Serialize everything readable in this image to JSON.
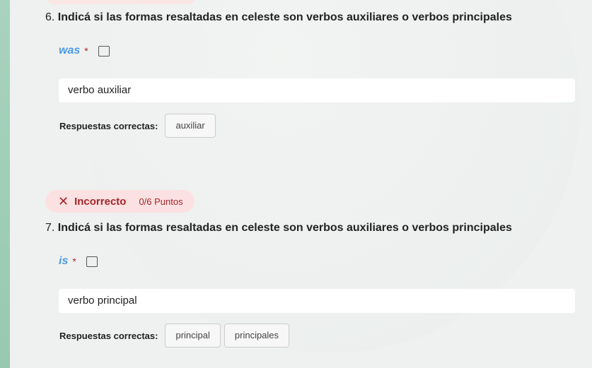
{
  "questions": [
    {
      "number": "6.",
      "title": "Indicá si las formas resaltadas en celeste son verbos auxiliares o verbos principales",
      "word": "was",
      "required": "*",
      "answer": "verbo auxiliar",
      "correct_label": "Respuestas correctas:",
      "correct": [
        "auxiliar"
      ]
    },
    {
      "number": "7.",
      "title": "Indicá si las formas resaltadas en celeste son verbos auxiliares o verbos principales",
      "word": "is",
      "required": "*",
      "answer": "verbo principal",
      "correct_label": "Respuestas correctas:",
      "correct": [
        "principal",
        "principales"
      ],
      "status": "Incorrecto",
      "points": "0/6 Puntos",
      "status_icon": "x"
    }
  ]
}
